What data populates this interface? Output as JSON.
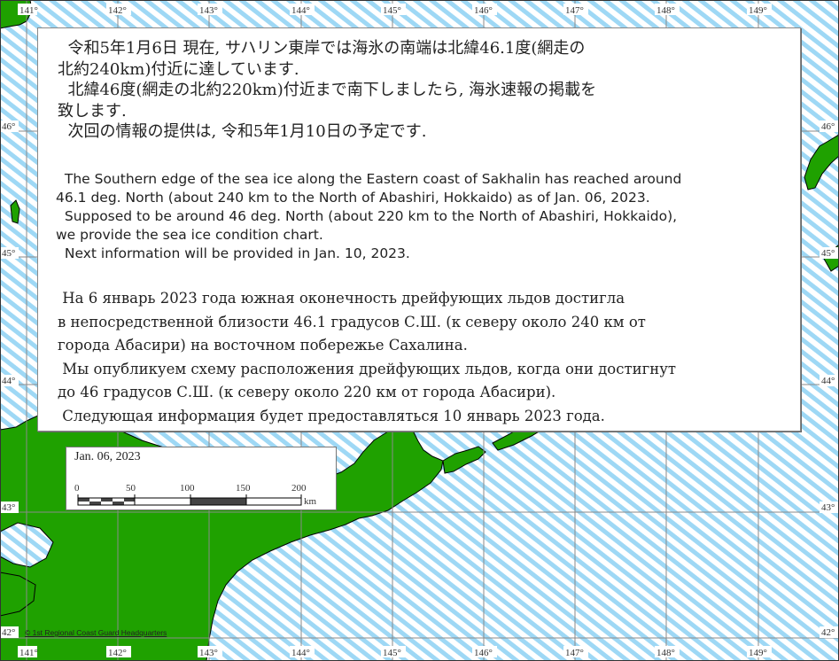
{
  "map": {
    "lon_labels": [
      "141°",
      "142°",
      "143°",
      "144°",
      "145°",
      "146°",
      "147°",
      "148°",
      "149°"
    ],
    "lat_labels": [
      "46°",
      "45°",
      "44°",
      "43°",
      "42°"
    ],
    "colors": {
      "sea": "#ffffff",
      "sea_ice_hatch": "#9ed8f5",
      "land": "#1fa100",
      "coast": "#000000",
      "grid": "#8a8a8a"
    }
  },
  "notice": {
    "ja": "  令和5年1月6日 現在, サハリン東岸では海氷の南端は北緯46.1度(網走の\n北約240km)付近に達しています.\n  北緯46度(網走の北約220km)付近まで南下しましたら, 海氷速報の掲載を\n致します.\n  次回の情報の提供は, 令和5年1月10日の予定です.",
    "en": "  The Southern edge of the sea ice along the Eastern coast of Sakhalin has reached around\n46.1 deg. North (about 240 km to the North of Abashiri, Hokkaido) as of Jan. 06, 2023.\n  Supposed to be around 46 deg. North (about 220 km to the North of Abashiri, Hokkaido),\nwe provide the sea ice condition chart.\n  Next information will be provided in Jan. 10, 2023.",
    "ru": " На 6 январь 2023 года южная оконечность дрейфующих льдов достигла\nв непосредственной близости 46.1 градусов С.Ш. (к северу около 240 км от\nгорода Абасири) на восточном побережье Сахалина.\n Мы опубликуем схему расположения дрейфующих льдов, когда они достигнут\nдо 46 градусов С.Ш. (к северу около 220 км от города Абасири).\n Следующая информация будет предоставляться 10 январь 2023 года."
  },
  "scale": {
    "date": "Jan. 06, 2023",
    "ticks": [
      "0",
      "50",
      "100",
      "150",
      "200"
    ],
    "unit": "km"
  },
  "credit": "© 1st Regional Coast Guard Headquarters"
}
